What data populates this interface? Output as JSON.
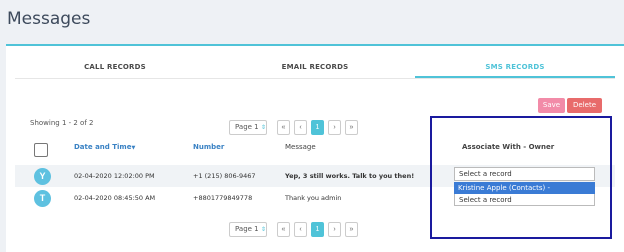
{
  "page": {
    "title": "Messages"
  },
  "tabs": [
    {
      "label": "CALL RECORDS"
    },
    {
      "label": "EMAIL RECORDS"
    },
    {
      "label": "SMS RECORDS"
    }
  ],
  "toolbar": {
    "save_label": "Save",
    "delete_label": "Delete"
  },
  "showing": "Showing 1 - 2 of 2",
  "pager": {
    "page_label": "Page 1",
    "first": "«",
    "prev": "‹",
    "current": "1",
    "next": "›",
    "last": "»"
  },
  "table": {
    "headers": {
      "date": "Date and Time",
      "number": "Number",
      "message": "Message",
      "associate": "Associate With - Owner"
    },
    "rows": [
      {
        "avatar": "Y",
        "date": "02-04-2020 12:02:00 PM",
        "number": "+1 (215) 806-9467",
        "message": "Yep, 3 still works. Talk to you then!",
        "associate": "Select a record"
      },
      {
        "avatar": "T",
        "date": "02-04-2020 08:45:50 AM",
        "number": "+8801779849778",
        "message": "Thank you admin",
        "associate": "Select a record"
      }
    ],
    "dropdown_options": [
      "Kristine Apple (Contacts) - Administrator",
      "Select a record"
    ]
  },
  "colors": {
    "accent": "#4fc3d8",
    "link": "#3a82c4",
    "save": "#f28ba8",
    "delete": "#e86b6b",
    "highlight_border": "#1a1a9e"
  }
}
